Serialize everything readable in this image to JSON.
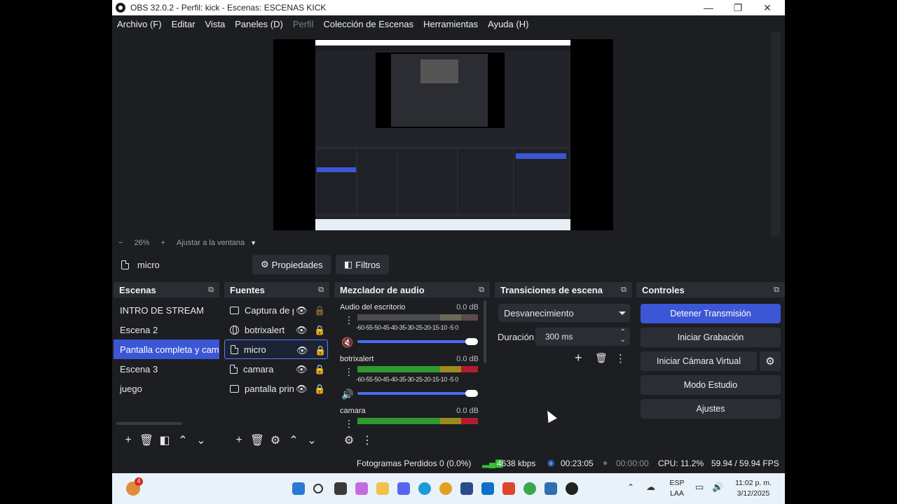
{
  "window": {
    "title": "OBS 32.0.2 - Perfil: kick - Escenas: ESCENAS KICK",
    "controls": {
      "minimize": "—",
      "maximize": "❐",
      "close": "✕"
    }
  },
  "menu": [
    {
      "label": "Archivo (F)",
      "enabled": true
    },
    {
      "label": "Editar",
      "enabled": true
    },
    {
      "label": "Vista",
      "enabled": true
    },
    {
      "label": "Paneles (D)",
      "enabled": true
    },
    {
      "label": "Perfil",
      "enabled": false
    },
    {
      "label": "Colección de Escenas",
      "enabled": true
    },
    {
      "label": "Herramientas",
      "enabled": true
    },
    {
      "label": "Ayuda (H)",
      "enabled": true
    }
  ],
  "zoom": {
    "minus": "−",
    "value": "26%",
    "plus": "+",
    "fit": "Ajustar a la ventana"
  },
  "source_bar": {
    "selected_source": "micro",
    "properties": "Propiedades",
    "filters": "Filtros"
  },
  "scenes": {
    "title": "Escenas",
    "items": [
      {
        "label": "INTRO DE STREAM",
        "selected": false
      },
      {
        "label": "Escena 2",
        "selected": false
      },
      {
        "label": "Pantalla completa y camara",
        "selected": true
      },
      {
        "label": "Escena 3",
        "selected": false
      },
      {
        "label": "juego",
        "selected": false
      }
    ]
  },
  "sources": {
    "title": "Fuentes",
    "items": [
      {
        "label": "Captura de pantalla",
        "icon": "monitor-icon",
        "selected": false
      },
      {
        "label": "botrixalert",
        "icon": "globe-icon",
        "selected": false
      },
      {
        "label": "micro",
        "icon": "file-icon",
        "selected": true
      },
      {
        "label": "camara",
        "icon": "file-icon",
        "selected": false
      },
      {
        "label": "pantalla principal",
        "icon": "monitor-icon",
        "selected": false
      }
    ]
  },
  "mixer": {
    "title": "Mezclador de audio",
    "scale": "-60-55-50-45-40-35-30-25-20-15-10 -5  0",
    "channels": [
      {
        "name": "Audio del escritorio",
        "db": "0.0 dB",
        "muted": true,
        "level": 1.0
      },
      {
        "name": "botrixalert",
        "db": "0.0 dB",
        "muted": false,
        "level": 1.0
      },
      {
        "name": "camara",
        "db": "0.0 dB",
        "muted": false,
        "level": 1.0
      }
    ]
  },
  "transitions": {
    "title": "Transiciones de escena",
    "selected": "Desvanecimiento",
    "duration_label": "Duración",
    "duration": "300 ms"
  },
  "controls": {
    "title": "Controles",
    "stop_stream": "Detener Transmisión",
    "start_recording": "Iniciar Grabación",
    "virtual_camera": "Iniciar Cámara Virtual",
    "studio_mode": "Modo Estudio",
    "settings": "Ajustes"
  },
  "status": {
    "dropped_frames": "Fotogramas Perdidos 0 (0.0%)",
    "bitrate": "4638 kbps",
    "stream_time": "00:23:05",
    "record_time": "00:00:00",
    "cpu": "CPU: 11.2%",
    "fps": "59.94 / 59.94 FPS"
  },
  "taskbar": {
    "notification_badge": "4",
    "language_top": "ESP",
    "language_bottom": "LAA",
    "time": "11:02 p. m.",
    "date": "3/12/2025"
  },
  "colors": {
    "accent": "#3b57d6",
    "panel": "#1d1e22",
    "dock_header": "#2b2d35",
    "meter_green": "#2e9a2e",
    "meter_yellow": "#9b8a1e",
    "meter_red": "#b01e2e"
  }
}
